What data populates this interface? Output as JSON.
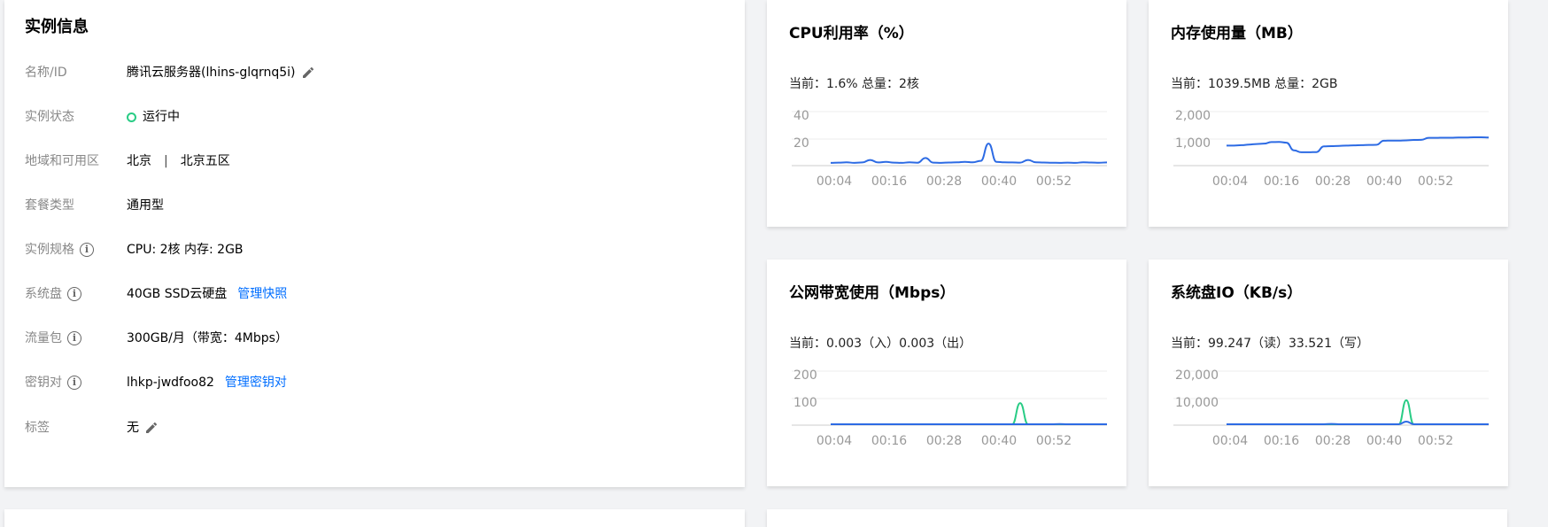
{
  "instance": {
    "title": "实例信息",
    "rows": [
      {
        "label": "名称/ID",
        "value": "腾讯云服务器(lhins-glqrnq5i)"
      },
      {
        "label": "实例状态",
        "value": "运行中"
      },
      {
        "label": "地域和可用区",
        "region": "北京",
        "separator": "|",
        "zone": "北京五区"
      },
      {
        "label": "套餐类型",
        "value": "通用型"
      },
      {
        "label": "实例规格",
        "value": "CPU: 2核 内存: 2GB"
      },
      {
        "label": "系统盘",
        "value": "40GB SSD云硬盘",
        "link": "管理快照"
      },
      {
        "label": "流量包",
        "value": "300GB/月（带宽：4Mbps）"
      },
      {
        "label": "密钥对",
        "value": "lhkp-jwdfoo82",
        "link": "管理密钥对"
      },
      {
        "label": "标签",
        "value": "无"
      }
    ],
    "info_glyph": "i"
  },
  "metrics": [
    {
      "title": "CPU利用率（%）",
      "current": "当前：1.6% 总量：2核",
      "chart_data": {
        "type": "line",
        "y_ticks": [
          "40",
          "20"
        ],
        "x_ticks": [
          "00:04",
          "00:16",
          "00:28",
          "00:40",
          "00:52"
        ],
        "ylim": [
          0,
          60
        ],
        "series": [
          {
            "color": "#2d6be4",
            "values": [
              2.0,
              2.2,
              2.5,
              2.0,
              2.4,
              5.0,
              2.4,
              3.0,
              2.2,
              2.0,
              2.5,
              2.1,
              7.0,
              2.2,
              2.0,
              2.3,
              2.5,
              3.0,
              2.5,
              4.0,
              22,
              3.0,
              2.5,
              2.4,
              2.2,
              5.0,
              2.5,
              2.3,
              2.1,
              2.0,
              2.2,
              2.0,
              2.5,
              2.3,
              2.1,
              2.4
            ]
          }
        ]
      }
    },
    {
      "title": "内存使用量（MB）",
      "current": "当前：1039.5MB 总量：2GB",
      "chart_data": {
        "type": "line",
        "y_ticks": [
          "2,000",
          "1,000"
        ],
        "x_ticks": [
          "00:04",
          "00:16",
          "00:28",
          "00:40",
          "00:52"
        ],
        "ylim": [
          0,
          3000
        ],
        "series": [
          {
            "color": "#2d6be4",
            "values": [
              1000,
              1000,
              1020,
              1050,
              1080,
              1100,
              1180,
              1190,
              1150,
              750,
              650,
              650,
              660,
              960,
              970,
              980,
              1000,
              1010,
              1020,
              1030,
              1040,
              1250,
              1260,
              1260,
              1270,
              1290,
              1300,
              1400,
              1400,
              1410,
              1410,
              1420,
              1420,
              1430,
              1430,
              1420
            ]
          }
        ]
      }
    },
    {
      "title": "公网带宽使用（Mbps）",
      "current": "当前：0.003（入）0.003（出）",
      "chart_data": {
        "type": "line",
        "y_ticks": [
          "200",
          "100"
        ],
        "x_ticks": [
          "00:04",
          "00:16",
          "00:28",
          "00:40",
          "00:52"
        ],
        "ylim": [
          0,
          300
        ],
        "series": [
          {
            "color": "#29cc85",
            "values": [
              0,
              0,
              0,
              0,
              0,
              0,
              0,
              0,
              0,
              0,
              0,
              0,
              0,
              0,
              0,
              0,
              0,
              0,
              0,
              0,
              0,
              0,
              0,
              0,
              110,
              0,
              0,
              0,
              0,
              0,
              0,
              0,
              0,
              0,
              0,
              0
            ]
          },
          {
            "color": "#2d6be4",
            "values": [
              0,
              0,
              0,
              0,
              0,
              0,
              0,
              0,
              0,
              0,
              0,
              0,
              0,
              0,
              0,
              0,
              0,
              0,
              0,
              0,
              0,
              0,
              0,
              0,
              0,
              0,
              0,
              0,
              0,
              1,
              0,
              0,
              0,
              0,
              0,
              0
            ]
          }
        ]
      }
    },
    {
      "title": "系统盘IO（KB/s）",
      "current": "当前：99.247（读）33.521（写）",
      "chart_data": {
        "type": "line",
        "y_ticks": [
          "20,000",
          "10,000"
        ],
        "x_ticks": [
          "00:04",
          "00:16",
          "00:28",
          "00:40",
          "00:52"
        ],
        "ylim": [
          0,
          30000
        ],
        "series": [
          {
            "color": "#29cc85",
            "values": [
              0,
              0,
              0,
              0,
              0,
              0,
              0,
              0,
              0,
              0,
              0,
              0,
              0,
              0,
              0,
              0,
              0,
              0,
              0,
              0,
              0,
              0,
              0,
              0,
              12500,
              0,
              0,
              0,
              0,
              0,
              0,
              0,
              0,
              0,
              0,
              0
            ]
          },
          {
            "color": "#2d6be4",
            "values": [
              0,
              0,
              0,
              0,
              0,
              0,
              0,
              0,
              0,
              0,
              0,
              0,
              0,
              0,
              200,
              0,
              0,
              0,
              0,
              0,
              0,
              0,
              0,
              0,
              1400,
              0,
              0,
              0,
              0,
              0,
              0,
              0,
              0,
              0,
              0,
              0
            ]
          }
        ]
      }
    }
  ]
}
